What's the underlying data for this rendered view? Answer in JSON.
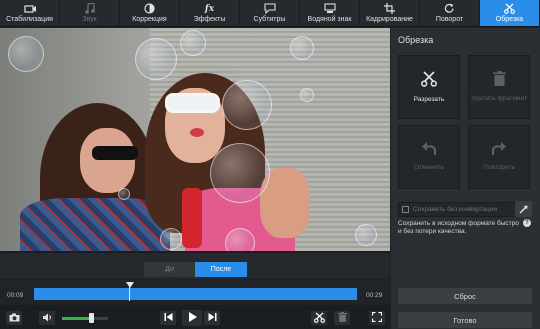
{
  "toolbar": {
    "tabs": [
      {
        "label": "Стабилизация",
        "icon": "stabilization-icon"
      },
      {
        "label": "Звук",
        "icon": "music-note-icon"
      },
      {
        "label": "Коррекция",
        "icon": "contrast-icon"
      },
      {
        "label": "Эффекты",
        "icon": "fx-icon"
      },
      {
        "label": "Субтитры",
        "icon": "speech-bubble-icon"
      },
      {
        "label": "Водяной знак",
        "icon": "watermark-icon"
      },
      {
        "label": "Кадрирование",
        "icon": "crop-icon"
      },
      {
        "label": "Поворот",
        "icon": "rotate-icon"
      },
      {
        "label": "Обрезка",
        "icon": "scissors-icon"
      }
    ],
    "active_index": 8,
    "disabled_index": 1
  },
  "preview": {
    "before_label": "До",
    "after_label": "После",
    "active": "after"
  },
  "timeline": {
    "start_time": "00:09",
    "end_time": "00:29",
    "playhead_fraction": 0.295
  },
  "controls": {
    "volume_fraction": 0.62,
    "icons": [
      "camera-icon",
      "speaker-icon",
      "skip-back-icon",
      "play-icon",
      "skip-forward-icon",
      "scissors-icon",
      "trash-icon",
      "fullscreen-icon"
    ]
  },
  "panel": {
    "title": "Обрезка",
    "tools": [
      {
        "label": "Разрезать",
        "enabled": true
      },
      {
        "label": "Удалить фрагмент",
        "enabled": false
      },
      {
        "label": "Отменить",
        "enabled": false
      },
      {
        "label": "Повторить",
        "enabled": false
      }
    ],
    "no_convert_label": "Сохранить без конвертации",
    "description": "Сохранить в исходном формате быстро и без потери качества.",
    "help_glyph": "?",
    "reset_label": "Сброс",
    "done_label": "Готово"
  },
  "colors": {
    "accent": "#2a8ee8",
    "background": "#1e2226",
    "panel": "#2b2e32",
    "volume": "#36b34a"
  }
}
